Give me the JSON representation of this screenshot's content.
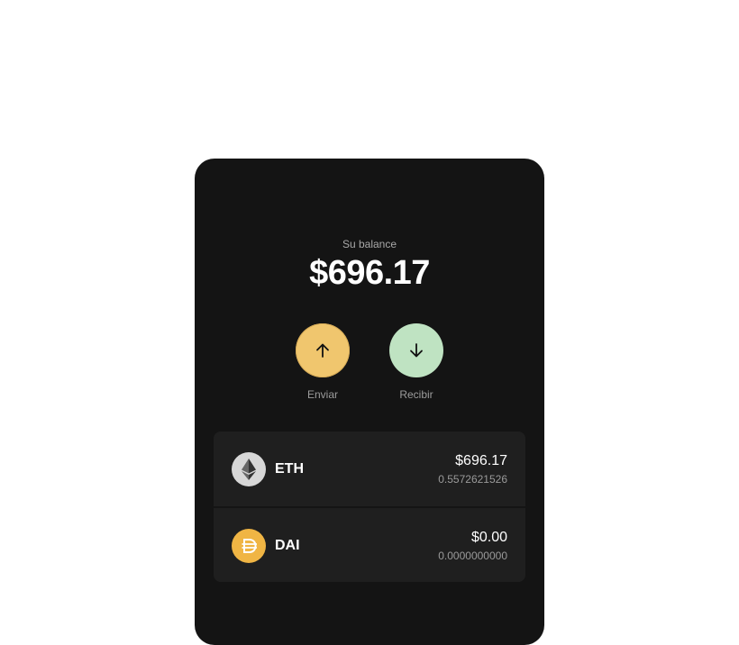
{
  "balance": {
    "label": "Su balance",
    "amount": "$696.17"
  },
  "actions": {
    "send": {
      "label": "Enviar",
      "icon": "arrow-up-icon",
      "color": "#f0c66e"
    },
    "receive": {
      "label": "Recibir",
      "icon": "arrow-down-icon",
      "color": "#bfe3c2"
    }
  },
  "tokens": [
    {
      "symbol": "ETH",
      "fiat": "$696.17",
      "amount": "0.5572621526",
      "icon": "ethereum-icon",
      "color": "#d7d7d7"
    },
    {
      "symbol": "DAI",
      "fiat": "$0.00",
      "amount": "0.0000000000",
      "icon": "dai-icon",
      "color": "#f0b544"
    }
  ]
}
